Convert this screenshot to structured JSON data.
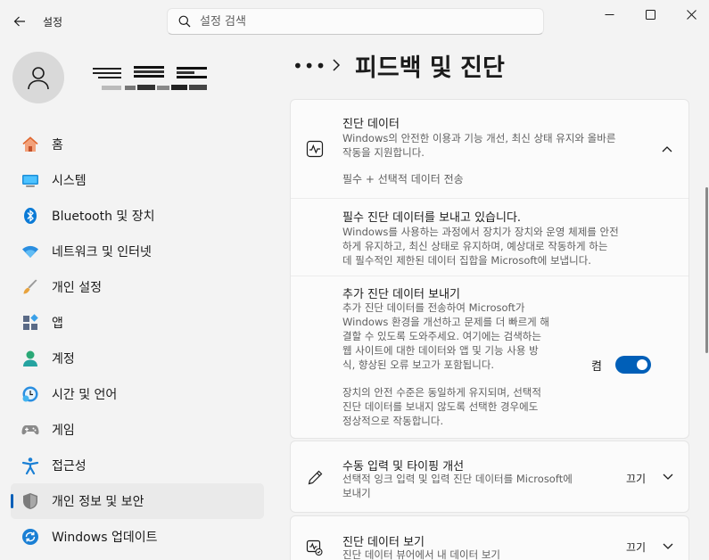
{
  "window": {
    "title": "설정"
  },
  "search": {
    "placeholder": "설정 검색"
  },
  "sidebar": {
    "items": [
      {
        "label": "홈",
        "icon": "home-icon"
      },
      {
        "label": "시스템",
        "icon": "monitor-icon"
      },
      {
        "label": "Bluetooth 및 장치",
        "icon": "bluetooth-icon"
      },
      {
        "label": "네트워크 및 인터넷",
        "icon": "wifi-icon"
      },
      {
        "label": "개인 설정",
        "icon": "brush-icon"
      },
      {
        "label": "앱",
        "icon": "apps-icon"
      },
      {
        "label": "계정",
        "icon": "person-icon"
      },
      {
        "label": "시간 및 언어",
        "icon": "clock-globe-icon"
      },
      {
        "label": "게임",
        "icon": "gamepad-icon"
      },
      {
        "label": "접근성",
        "icon": "accessibility-icon"
      },
      {
        "label": "개인 정보 및 보안",
        "icon": "shield-icon",
        "active": true
      },
      {
        "label": "Windows 업데이트",
        "icon": "refresh-icon"
      }
    ]
  },
  "breadcrumb": {
    "dots": "•••",
    "title": "피드백 및 진단"
  },
  "diag": {
    "title": "진단 데이터",
    "desc_1": "Windows의 안전한 이용과 기능 개선, 최신 상태 유지와 올바른",
    "desc_2": "작동을 지원합니다.",
    "status": "필수 + 선택적 데이터 전송"
  },
  "required": {
    "title": "필수 진단 데이터를 보내고 있습니다.",
    "desc_1": "Windows를 사용하는 과정에서 장치가 장치와 운영 체제를 안전",
    "desc_2": "하게 유지하고, 최신 상태로 유지하며, 예상대로 작동하게 하는",
    "desc_3": "데 필수적인 제한된 데이터 집합을 Microsoft에 보냅니다."
  },
  "optional": {
    "title": "추가 진단 데이터 보내기",
    "desc_1": "추가 진단 데이터를 전송하여 Microsoft가",
    "desc_2": "Windows 환경을 개선하고 문제를 더 빠르게 해",
    "desc_3": "결할 수 있도록 도와주세요. 여기에는 검색하는",
    "desc_4": "웹 사이트에 대한 데이터와 앱 및 기능 사용 방",
    "desc_5": "식, 향상된 오류 보고가 포함됩니다.",
    "note_1": "장치의 안전 수준은 동일하게 유지되며, 선택적",
    "note_2": "진단 데이터를 보내지 않도록 선택한 경우에도",
    "note_3": "정상적으로 작동합니다.",
    "toggle_label": "켬",
    "toggle_on": true
  },
  "inking": {
    "title": "수동 입력 및 타이핑 개선",
    "desc_1": "선택적 잉크 입력 및 입력 진단 데이터를 Microsoft에",
    "desc_2": "보내기",
    "status": "끄기"
  },
  "viewer": {
    "title": "진단 데이터 보기",
    "desc_1": "진단 데이터 뷰어에서 내 데이터 보기",
    "status": "끄기"
  },
  "colors": {
    "accent": "#005fb8",
    "background": "#f3f3f3",
    "card": "#fbfbfb"
  }
}
